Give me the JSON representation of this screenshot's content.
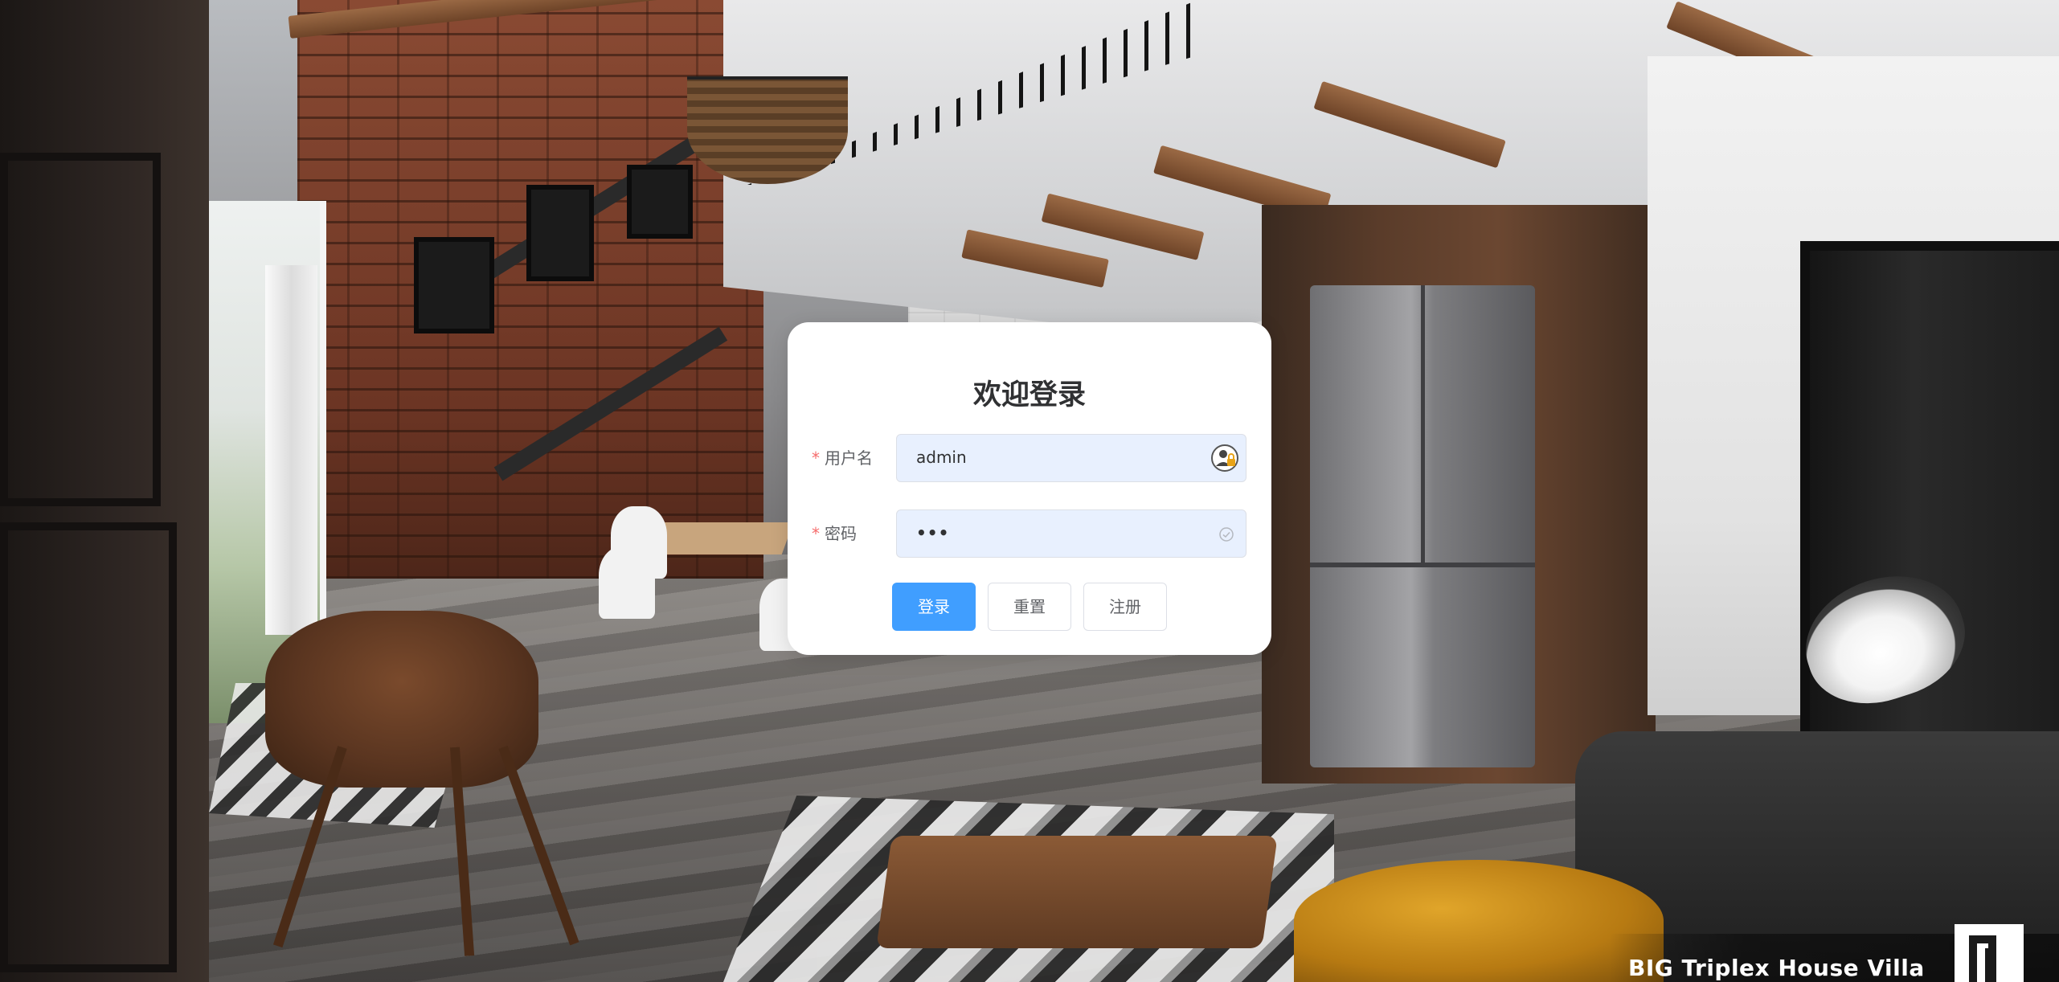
{
  "login": {
    "title": "欢迎登录",
    "username": {
      "label": "用户名",
      "required_mark": "*",
      "value": "admin",
      "icon": "autofill-key-icon"
    },
    "password": {
      "label": "密码",
      "required_mark": "*",
      "masked_value": "•••",
      "icon": "check-circle-icon"
    },
    "buttons": {
      "login": "登录",
      "reset": "重置",
      "register": "注册"
    }
  },
  "watermark": {
    "text": "BIG Triplex House Villa"
  },
  "colors": {
    "primary": "#409eff",
    "required": "#f56c6c",
    "input_autofill_bg": "#e8f0fe",
    "card_bg": "#ffffff"
  }
}
